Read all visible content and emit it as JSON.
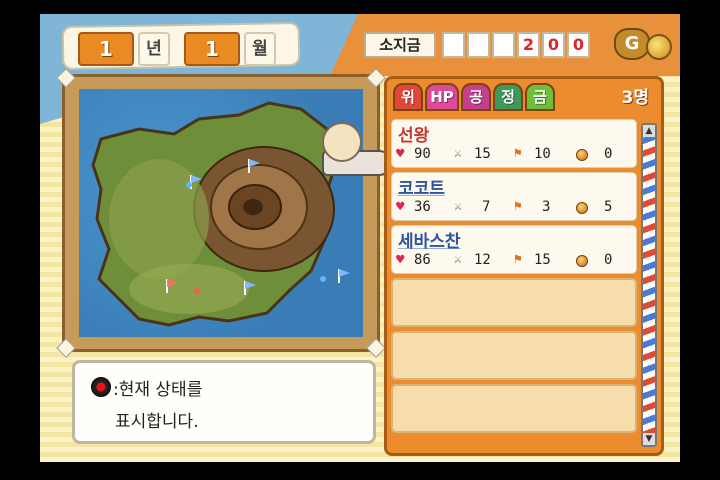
{
  "date": {
    "year": "1",
    "year_unit": "년",
    "month": "1",
    "month_unit": "월"
  },
  "money": {
    "label": "소지금",
    "digits": [
      "",
      "",
      "",
      "2",
      "0",
      "0"
    ],
    "currency_icon": "G"
  },
  "tabs": [
    {
      "label": "위",
      "color": "#e2483a"
    },
    {
      "label": "HP",
      "color": "#e0489c"
    },
    {
      "label": "공",
      "color": "#c63f8e"
    },
    {
      "label": "정",
      "color": "#3f9a5a"
    },
    {
      "label": "금",
      "color": "#6fbf3a"
    }
  ],
  "party_count": "3명",
  "party": [
    {
      "name": "선왕",
      "hp": "90",
      "atk": "15",
      "flag": "10",
      "gold": "0"
    },
    {
      "name": "코코트",
      "hp": "36",
      "atk": "7",
      "flag": "3",
      "gold": "5"
    },
    {
      "name": "세바스찬",
      "hp": "86",
      "atk": "12",
      "flag": "15",
      "gold": "0"
    }
  ],
  "message": {
    "line1": ":현재 상태를",
    "line2": "표시합니다."
  },
  "icons": {
    "hp": "heart-icon",
    "atk": "sword-icon",
    "flag": "flag-icon",
    "gold": "coin-icon",
    "gold_bag": "gold-bag-icon",
    "button": "circle-button-icon"
  }
}
